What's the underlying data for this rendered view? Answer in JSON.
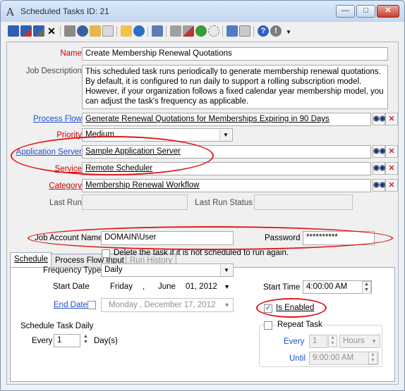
{
  "window": {
    "title": "Scheduled Tasks ID: 21",
    "app_icon": "A",
    "minimize_glyph": "—",
    "maximize_glyph": "□",
    "close_glyph": "✕"
  },
  "form": {
    "name_label": "Name",
    "name_value": "Create Membership Renewal Quotations",
    "description_label": "Job Description",
    "description_value": "This scheduled task runs periodically to generate membership renewal quotations. By default, it is configured to run daily to support a rolling subscription model. However, if your organization follows a fixed calendar year membership model, you can adjust the task's frequency as applicable.",
    "process_flow_label": "Process Flow",
    "process_flow_value": "Generate Renewal Quotations for Memberships Expiring in 90 Days",
    "priority_label": "Priority",
    "priority_value": "Medium",
    "app_server_label": "Application Server",
    "app_server_value": "Sample Application Server",
    "service_label": "Service",
    "service_value": "Remote Scheduler",
    "category_label": "Category",
    "category_value": "Membership Renewal Workflow",
    "last_run_label": "Last Run",
    "last_run_value": "",
    "last_run_status_label": "Last Run Status",
    "last_run_status_value": ""
  },
  "tabs": [
    {
      "label": "Schedule"
    },
    {
      "label": "Process Flow Input"
    },
    {
      "label": "Run History"
    }
  ],
  "schedule": {
    "job_account_label": "Job Account Name",
    "job_account_value": "DOMAIN\\User",
    "password_label": "Password",
    "password_value": "**********",
    "delete_task_label": "Delete the task if it is not scheduled to run again.",
    "frequency_label": "Frequency Type",
    "frequency_value": "Daily",
    "start_date_label": "Start Date",
    "start_date_day": "Friday",
    "start_date_sep1": ",",
    "start_date_month": "June",
    "start_date_rest": "01, 2012",
    "start_time_label": "Start Time",
    "start_time_value": "4:00:00 AM",
    "end_date_label": "End Date",
    "end_date_value": "Monday   , December  17, 2012",
    "is_enabled_label": "Is Enabled",
    "is_enabled_checked": true,
    "daily_group_label": "Schedule Task Daily",
    "every_label": "Every",
    "every_value": "1",
    "days_label": "Day(s)",
    "repeat_task_label": "Repeat Task",
    "repeat_every_label": "Every",
    "repeat_every_value": "1",
    "repeat_unit_value": "Hours",
    "until_label": "Until",
    "until_value": "9:00:00 AM"
  },
  "icons": {
    "search": "binoculars-icon",
    "clear": "red-x-icon",
    "dropdown": "chevron-down-icon"
  },
  "colors": {
    "required_label": "#cc0000",
    "link_label": "#1d4fd1",
    "annotation_ellipse": "#e01a1a"
  }
}
